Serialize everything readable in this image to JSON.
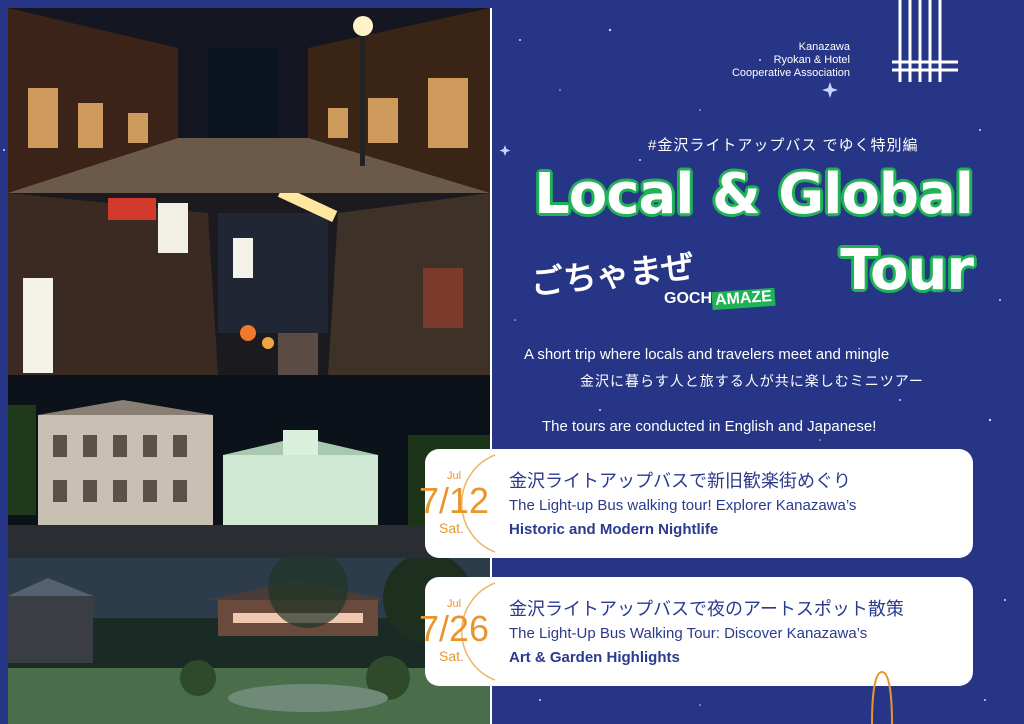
{
  "brand": {
    "line1": "Kanazawa",
    "line2": "Ryokan & Hotel",
    "line3": "Cooperative Association"
  },
  "hashtag": "#金沢ライトアップバス でゆく特別編",
  "title": {
    "line1": "Local & Global",
    "line2": "Tour",
    "gochamaze_jp": "ごちゃまぜ",
    "gochamaze_en_a": "GOCH",
    "gochamaze_en_b": "AMAZE"
  },
  "subtitle_en": "A short trip where locals and travelers meet and mingle",
  "subtitle_jp": "金沢に暮らす人と旅する人が共に楽しむミニツアー",
  "conducted": "The tours are conducted in English and Japanese!",
  "tours": [
    {
      "month": "Jul",
      "date": "7/12",
      "weekday": "Sat.",
      "title_jp": "金沢ライトアップバスで新旧歓楽街めぐり",
      "title_en": "The Light-up Bus walking tour! Explorer Kanazawa’s",
      "title_en_bold": "Historic and Modern Nightlife"
    },
    {
      "month": "Jul",
      "date": "7/26",
      "weekday": "Sat.",
      "title_jp": "金沢ライトアップバスで夜のアートスポット散策",
      "title_en": "The Light-Up Bus Walking Tour: Discover Kanazawa’s",
      "title_en_bold": "Art & Garden Highlights"
    }
  ],
  "colors": {
    "background": "#263585",
    "accent_green": "#1fb356",
    "accent_orange": "#e8962b",
    "card_text": "#2a3a8e"
  }
}
